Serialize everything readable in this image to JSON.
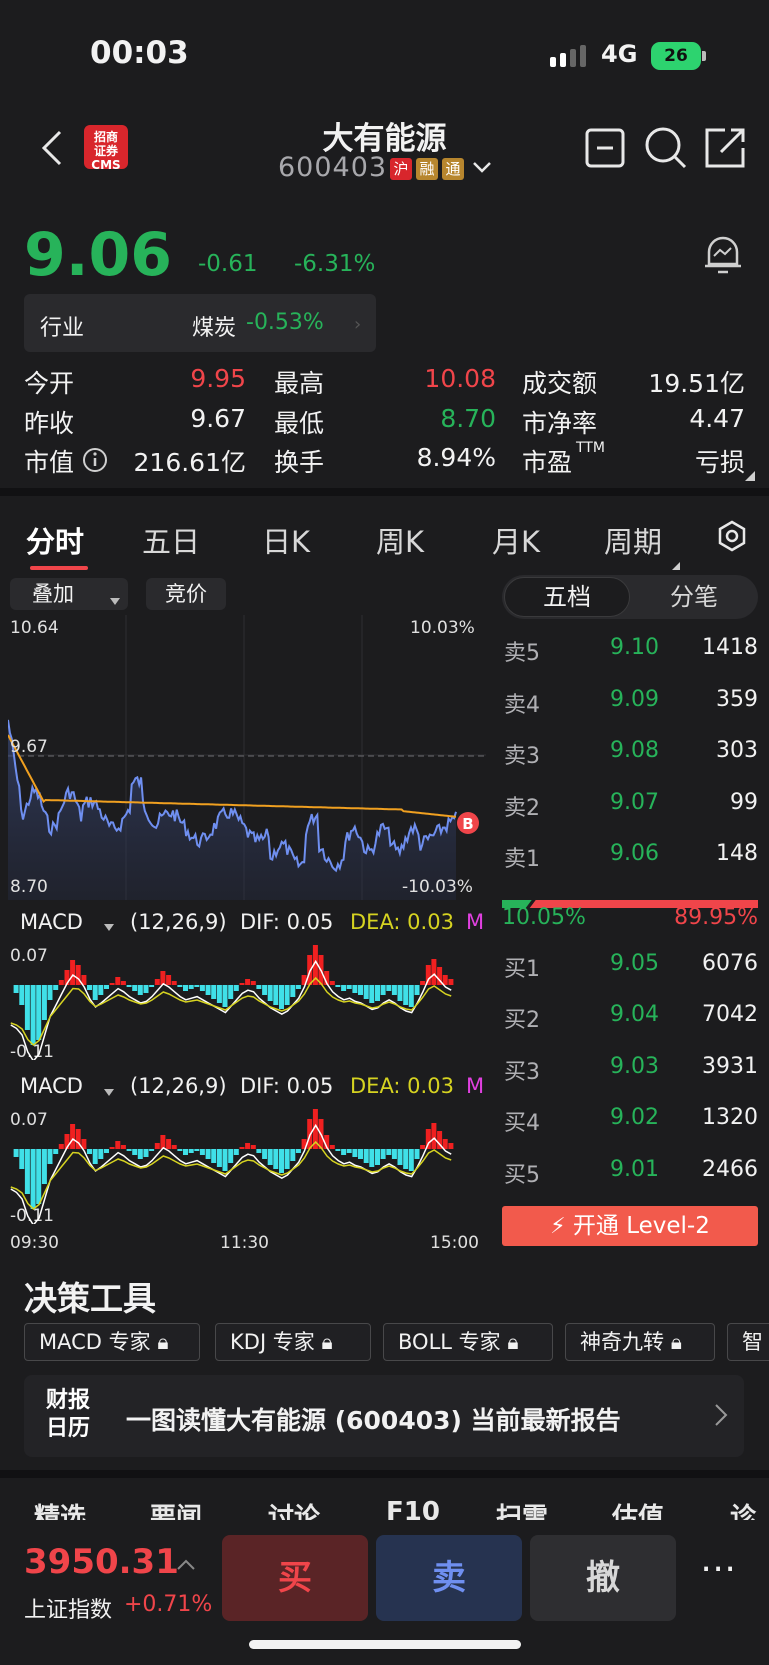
{
  "status": {
    "time": "00:03",
    "network": "4G",
    "battery": "26"
  },
  "header": {
    "broker_logo": "招商\n证券\nCMS",
    "name": "大有能源",
    "code": "600403",
    "tags": [
      "沪",
      "融",
      "通"
    ]
  },
  "quote": {
    "price": "9.06",
    "change": "-0.61",
    "change_pct": "-6.31%",
    "industry_label": "行业",
    "industry_name": "煤炭",
    "industry_chg": "-0.53%",
    "stats": [
      {
        "label": "今开",
        "value": "9.95"
      },
      {
        "label": "最高",
        "value": "10.08"
      },
      {
        "label": "成交额",
        "value": "19.51亿"
      },
      {
        "label": "昨收",
        "value": "9.67"
      },
      {
        "label": "最低",
        "value": "8.70"
      },
      {
        "label": "市净率",
        "value": "4.47"
      },
      {
        "label": "市值",
        "value": "216.61亿"
      },
      {
        "label": "换手",
        "value": "8.94%"
      },
      {
        "label": "市盈",
        "value": "亏损"
      }
    ],
    "pe_superscript": "TTM"
  },
  "tabs": [
    "分时",
    "五日",
    "日K",
    "周K",
    "月K",
    "周期"
  ],
  "chart": {
    "overlay_btn": "叠加",
    "auction_btn": "竞价",
    "high": "10.64",
    "high_pct": "10.03%",
    "prev_close": "9.67",
    "low": "8.70",
    "low_pct": "-10.03%",
    "buy_marker": "B",
    "macd1": {
      "name": "MACD",
      "params": "(12,26,9)",
      "dif": "DIF: 0.05",
      "dea": "DEA: 0.03",
      "m": "M",
      "top": "0.07",
      "bottom": "-0.11"
    },
    "macd2": {
      "name": "MACD",
      "params": "(12,26,9)",
      "dif": "DIF: 0.05",
      "dea": "DEA: 0.03",
      "m": "M",
      "top": "0.07",
      "bottom": "-0.11"
    },
    "times": [
      "09:30",
      "11:30",
      "15:00"
    ]
  },
  "chart_data": {
    "type": "line",
    "series": [],
    "ylim": [
      8.7,
      10.64
    ],
    "prev_close": 9.67,
    "x_ticks": [
      "09:30",
      "11:30",
      "15:00"
    ]
  },
  "orderbook": {
    "seg_on": "五档",
    "seg_off": "分笔",
    "sells": [
      {
        "label": "卖5",
        "price": "9.10",
        "vol": "1418"
      },
      {
        "label": "卖4",
        "price": "9.09",
        "vol": "359"
      },
      {
        "label": "卖3",
        "price": "9.08",
        "vol": "303"
      },
      {
        "label": "卖2",
        "price": "9.07",
        "vol": "99"
      },
      {
        "label": "卖1",
        "price": "9.06",
        "vol": "148"
      }
    ],
    "buy_ratio": "10.05%",
    "sell_ratio": "89.95%",
    "buy_ratio_value": 0.1005,
    "buys": [
      {
        "label": "买1",
        "price": "9.05",
        "vol": "6076"
      },
      {
        "label": "买2",
        "price": "9.04",
        "vol": "7042"
      },
      {
        "label": "买3",
        "price": "9.03",
        "vol": "3931"
      },
      {
        "label": "买4",
        "price": "9.02",
        "vol": "1320"
      },
      {
        "label": "买5",
        "price": "9.01",
        "vol": "2466"
      }
    ],
    "level2": "开通 Level-2"
  },
  "tools": {
    "title": "决策工具",
    "items": [
      "MACD 专家",
      "KDJ 专家",
      "BOLL 专家",
      "神奇九转",
      "智"
    ],
    "report_logo": "财报\n日历",
    "report_text": "一图读懂大有能源 (600403) 当前最新报告"
  },
  "bottom_tabs": [
    "精选",
    "要闻",
    "讨论",
    "F10",
    "扫雷",
    "估值",
    "诊股"
  ],
  "bottom": {
    "index_value": "3950.31",
    "index_name": "上证指数",
    "index_chg": "+0.71%",
    "buy": "买",
    "sell": "卖",
    "cancel": "撤",
    "more": "⋯"
  },
  "colors": {
    "up": "#f0454a",
    "down": "#27b35a",
    "avg_line": "#f0a020",
    "price_line": "#6f8ff0"
  }
}
